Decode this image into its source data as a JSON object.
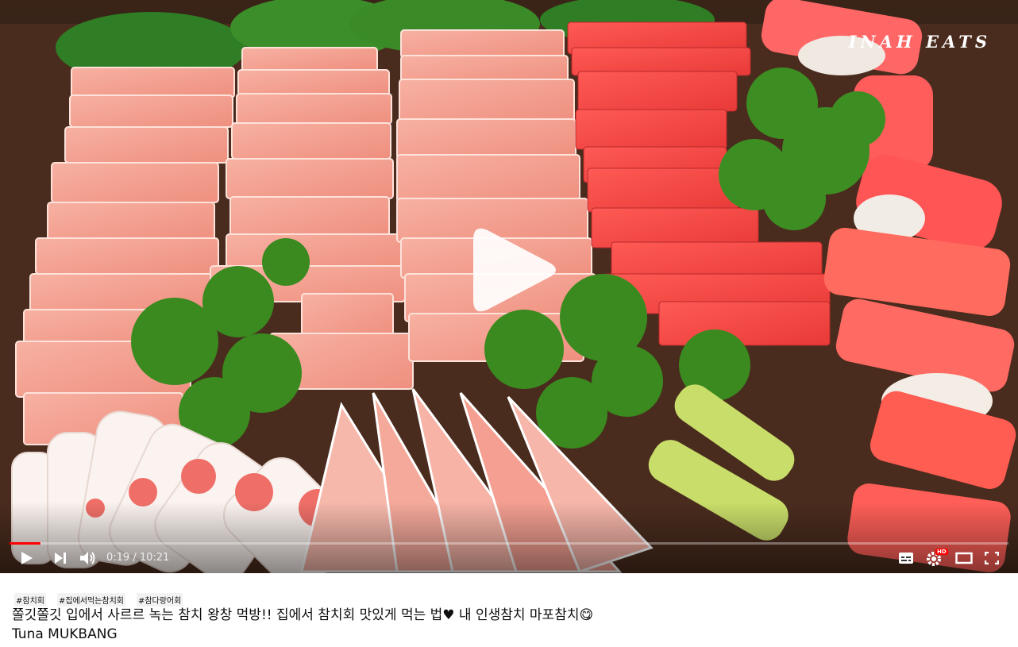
{
  "video": {
    "watermark": "INAH EATS",
    "current_time": "0:19",
    "separator": " / ",
    "duration": "10:21",
    "progress_fraction": 0.031,
    "controls": {
      "play": "play-icon",
      "next": "next-icon",
      "volume": "volume-icon",
      "subtitles": "subtitles-icon",
      "settings": "settings-icon",
      "settings_badge": "HD",
      "theater": "theater-icon",
      "fullscreen": "fullscreen-icon"
    },
    "colors": {
      "progress_played": "#ff0000",
      "hd_badge": "#ff0000"
    }
  },
  "tags": [
    "#참치회",
    "#집에서먹는참치회",
    "#참다랑어회"
  ],
  "title_line1": "쫄깃쫄깃 입에서 사르르 녹는 참치 왕창 먹방!! 집에서 참치회 맛있게 먹는 법♥ 내 인생참치 마포참치😋",
  "title_line2": "Tuna MUKBANG"
}
